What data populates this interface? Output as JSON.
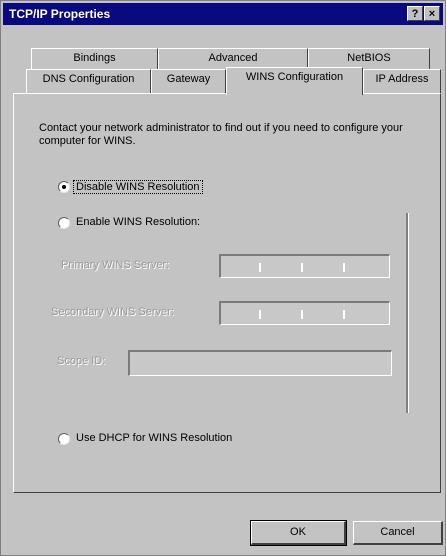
{
  "window": {
    "title": "TCP/IP Properties"
  },
  "titlebar": {
    "help_label": "?",
    "close_label": "×"
  },
  "tabs_row1": [
    {
      "label": "Bindings"
    },
    {
      "label": "Advanced"
    },
    {
      "label": "NetBIOS"
    }
  ],
  "tabs_row2": [
    {
      "label": "DNS Configuration"
    },
    {
      "label": "Gateway"
    },
    {
      "label": "WINS Configuration"
    },
    {
      "label": "IP Address"
    }
  ],
  "active_tab": "WINS Configuration",
  "description": "Contact your network administrator to find out if you need to configure your computer for WINS.",
  "options": {
    "disable": {
      "label": "Disable WINS Resolution",
      "selected": true
    },
    "enable": {
      "label": "Enable WINS Resolution:",
      "selected": false
    },
    "dhcp": {
      "label": "Use DHCP for WINS Resolution",
      "selected": false
    }
  },
  "fields": {
    "primary": {
      "label": "Primary WINS Server:",
      "value": ""
    },
    "secondary": {
      "label": "Secondary WINS Server:",
      "value": ""
    },
    "scope": {
      "label": "Scope ID:",
      "value": ""
    }
  },
  "buttons": {
    "ok": "OK",
    "cancel": "Cancel"
  }
}
